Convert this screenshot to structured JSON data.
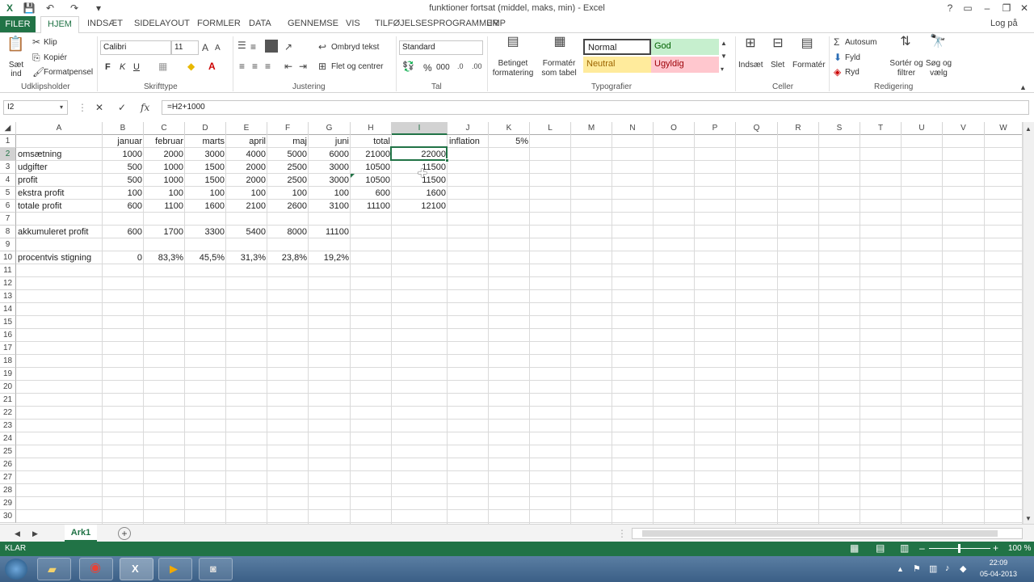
{
  "window": {
    "title": "funktioner fortsat (middel, maks, min) - Excel",
    "login": "Log på",
    "help": "?",
    "controls": [
      "▭",
      "–",
      "❐",
      "✕"
    ]
  },
  "tabs": [
    {
      "label": "FILER"
    },
    {
      "label": "HJEM"
    },
    {
      "label": "INDSÆT"
    },
    {
      "label": "SIDELAYOUT"
    },
    {
      "label": "FORMLER"
    },
    {
      "label": "DATA"
    },
    {
      "label": "GENNEMSE"
    },
    {
      "label": "VIS"
    },
    {
      "label": "TILFØJELSESPROGRAMMER"
    },
    {
      "label": "JMP"
    }
  ],
  "ribbon": {
    "clipboard": {
      "paste": "Sæt ind",
      "cut": "Klip",
      "copy": "Kopiér",
      "painter": "Formatpensel",
      "label": "Udklipsholder"
    },
    "font": {
      "name": "Calibri",
      "size": "11",
      "bold": "F",
      "italic": "K",
      "underline": "U",
      "label": "Skrifttype"
    },
    "alignment": {
      "wrap": "Ombryd tekst",
      "merge": "Flet og centrer",
      "label": "Justering"
    },
    "number": {
      "format": "Standard",
      "percent": "%",
      "thousands": "000",
      "label": "Tal"
    },
    "styles": {
      "conditional": "Betinget formatering",
      "table": "Formatér som tabel",
      "normal": "Normal",
      "good": "God",
      "neutral": "Neutral",
      "bad": "Ugyldig",
      "label": "Typografier"
    },
    "cells": {
      "insert": "Indsæt",
      "delete": "Slet",
      "format": "Formatér",
      "label": "Celler"
    },
    "editing": {
      "autosum": "Autosum",
      "fill": "Fyld",
      "clear": "Ryd",
      "sort": "Sortér og filtrer",
      "find": "Søg og vælg",
      "label": "Redigering"
    }
  },
  "formula_bar": {
    "name_box": "I2",
    "formula": "=H2+1000",
    "fx": "fx"
  },
  "columns": [
    "A",
    "B",
    "C",
    "D",
    "E",
    "F",
    "G",
    "H",
    "I",
    "J",
    "K",
    "L",
    "M",
    "N",
    "O",
    "P",
    "Q",
    "R",
    "S",
    "T",
    "U",
    "V",
    "W"
  ],
  "rows": [
    "1",
    "2",
    "3",
    "4",
    "5",
    "6",
    "7",
    "8",
    "9",
    "10",
    "11",
    "12",
    "13",
    "14",
    "15",
    "16",
    "17",
    "18",
    "19",
    "20",
    "21",
    "22",
    "23",
    "24",
    "25",
    "26",
    "27",
    "28",
    "29",
    "30"
  ],
  "cells": {
    "B1": "januar",
    "C1": "februar",
    "D1": "marts",
    "E1": "april",
    "F1": "maj",
    "G1": "juni",
    "H1": "total",
    "J1": "inflation",
    "K1": "5%",
    "A2": "omsætning",
    "B2": "1000",
    "C2": "2000",
    "D2": "3000",
    "E2": "4000",
    "F2": "5000",
    "G2": "6000",
    "H2": "21000",
    "I2": "22000",
    "A3": "udgifter",
    "B3": "500",
    "C3": "1000",
    "D3": "1500",
    "E3": "2000",
    "F3": "2500",
    "G3": "3000",
    "H3": "10500",
    "I3": "11500",
    "A4": "profit",
    "B4": "500",
    "C4": "1000",
    "D4": "1500",
    "E4": "2000",
    "F4": "2500",
    "G4": "3000",
    "H4": "10500",
    "I4": "11500",
    "A5": "ekstra profit",
    "B5": "100",
    "C5": "100",
    "D5": "100",
    "E5": "100",
    "F5": "100",
    "G5": "100",
    "H5": "600",
    "I5": "1600",
    "A6": "totale profit",
    "B6": "600",
    "C6": "1100",
    "D6": "1600",
    "E6": "2100",
    "F6": "2600",
    "G6": "3100",
    "H6": "11100",
    "I6": "12100",
    "A8": "akkumuleret profit",
    "B8": "600",
    "C8": "1700",
    "D8": "3300",
    "E8": "5400",
    "F8": "8000",
    "G8": "11100",
    "A10": "procentvis stigning",
    "B10": "0",
    "C10": "83,3%",
    "D10": "45,5%",
    "E10": "31,3%",
    "F10": "23,8%",
    "G10": "19,2%"
  },
  "sheet": {
    "active_tab": "Ark1",
    "add": "+"
  },
  "status": {
    "mode": "KLAR",
    "zoom": "100 %"
  },
  "taskbar": {
    "time": "22:09",
    "date": "05-04-2013"
  }
}
